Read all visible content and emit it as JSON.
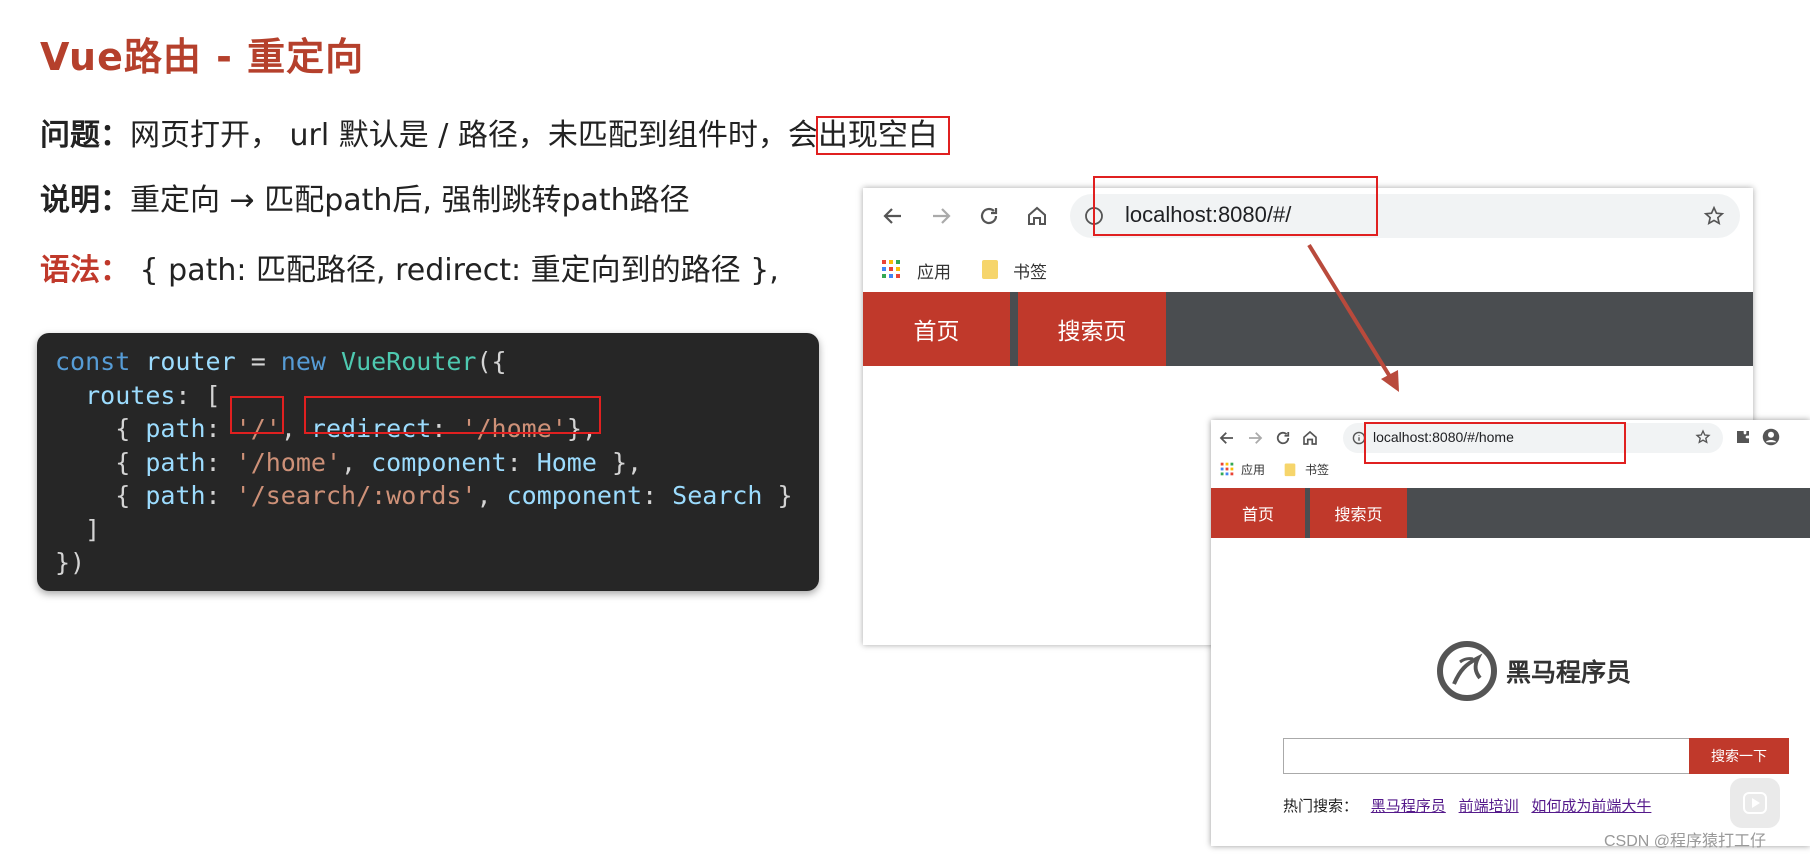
{
  "slide": {
    "title": "Vue路由 - 重定向",
    "problem_label": "问题：",
    "problem_text": "网页打开， url 默认是 / 路径，未匹配到组件时，会",
    "problem_highlight": "出现空白",
    "explain_label": "说明：",
    "explain_text": "重定向 → 匹配path后, 强制跳转path路径",
    "syntax_label": "语法：",
    "syntax_text": " { path: 匹配路径, redirect: 重定向到的路径 },"
  },
  "code": {
    "line1": {
      "kw1": "const",
      "var1": "router",
      "op": " = ",
      "kw2": "new",
      "cls": "VueRouter",
      "end": "({"
    },
    "line2": {
      "key": "routes",
      "rest": ": ["
    },
    "line3": {
      "open": "{ ",
      "key1": "path",
      "sep1": ": ",
      "str1": "'/'",
      "comma": ", ",
      "key2": "redirect",
      "sep2": ": ",
      "str2": "'/home'",
      "close": "},"
    },
    "line4": {
      "open": "{ ",
      "key1": "path",
      "sep1": ": ",
      "str1": "'/home'",
      "comma": ", ",
      "key2": "component",
      "sep2": ": ",
      "val2": "Home",
      "close": " },"
    },
    "line5": {
      "open": "{ ",
      "key1": "path",
      "sep1": ": ",
      "str1": "'/search/:words'",
      "comma": ", ",
      "key2": "component",
      "sep2": ": ",
      "val2": "Search",
      "close": " }"
    },
    "line6": "]",
    "line7": "})"
  },
  "browser_a": {
    "url": "localhost:8080/#/",
    "bookmarks": [
      "应用",
      "书签"
    ],
    "nav": [
      "首页",
      "搜索页"
    ]
  },
  "browser_b": {
    "url": "localhost:8080/#/home",
    "bookmarks": [
      "应用",
      "书签"
    ],
    "nav": [
      "首页",
      "搜索页"
    ],
    "logo_text": "黑马程序员",
    "search_button": "搜索一下",
    "hot_label": "热门搜索：",
    "hot_links": [
      "黑马程序员",
      "前端培训",
      "如何成为前端大牛"
    ]
  },
  "watermark": "CSDN @程序猿打工仔",
  "colors": {
    "accent": "#c0392b",
    "nav_bg": "#4a4d50",
    "highlight": "#e02020",
    "code_bg": "#262626"
  }
}
